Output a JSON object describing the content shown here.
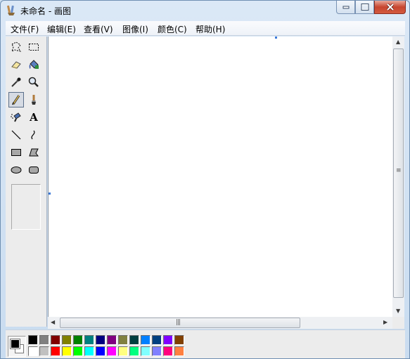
{
  "window": {
    "title": "未命名 - 画图"
  },
  "menu": [
    {
      "label": "文件(F)"
    },
    {
      "label": "编辑(E)"
    },
    {
      "label": "查看(V)"
    },
    {
      "label": "图像(I)"
    },
    {
      "label": "颜色(C)"
    },
    {
      "label": "帮助(H)"
    }
  ],
  "tools": [
    {
      "name": "free-form-select-icon"
    },
    {
      "name": "rectangle-select-icon"
    },
    {
      "name": "eraser-icon"
    },
    {
      "name": "fill-bucket-icon"
    },
    {
      "name": "color-picker-icon"
    },
    {
      "name": "magnifier-icon"
    },
    {
      "name": "pencil-icon",
      "selected": true
    },
    {
      "name": "brush-icon"
    },
    {
      "name": "airbrush-icon"
    },
    {
      "name": "text-icon",
      "glyph": "A"
    },
    {
      "name": "line-icon"
    },
    {
      "name": "curve-icon"
    },
    {
      "name": "rectangle-icon"
    },
    {
      "name": "polygon-icon"
    },
    {
      "name": "ellipse-icon"
    },
    {
      "name": "rounded-rectangle-icon"
    }
  ],
  "scrollbars": {
    "horizontal_grip": "|||",
    "vertical_grip": "≡"
  },
  "colors": {
    "foreground": "#000000",
    "background": "#ffffff",
    "palette_row1": [
      "#000000",
      "#808080",
      "#800000",
      "#808000",
      "#008000",
      "#008080",
      "#000080",
      "#800080",
      "#808040",
      "#004040",
      "#0080ff",
      "#004080",
      "#8000ff",
      "#804000"
    ],
    "palette_row2": [
      "#ffffff",
      "#c0c0c0",
      "#ff0000",
      "#ffff00",
      "#00ff00",
      "#00ffff",
      "#0000ff",
      "#ff00ff",
      "#ffff80",
      "#00ff80",
      "#80ffff",
      "#8080ff",
      "#ff0080",
      "#ff8040"
    ]
  }
}
